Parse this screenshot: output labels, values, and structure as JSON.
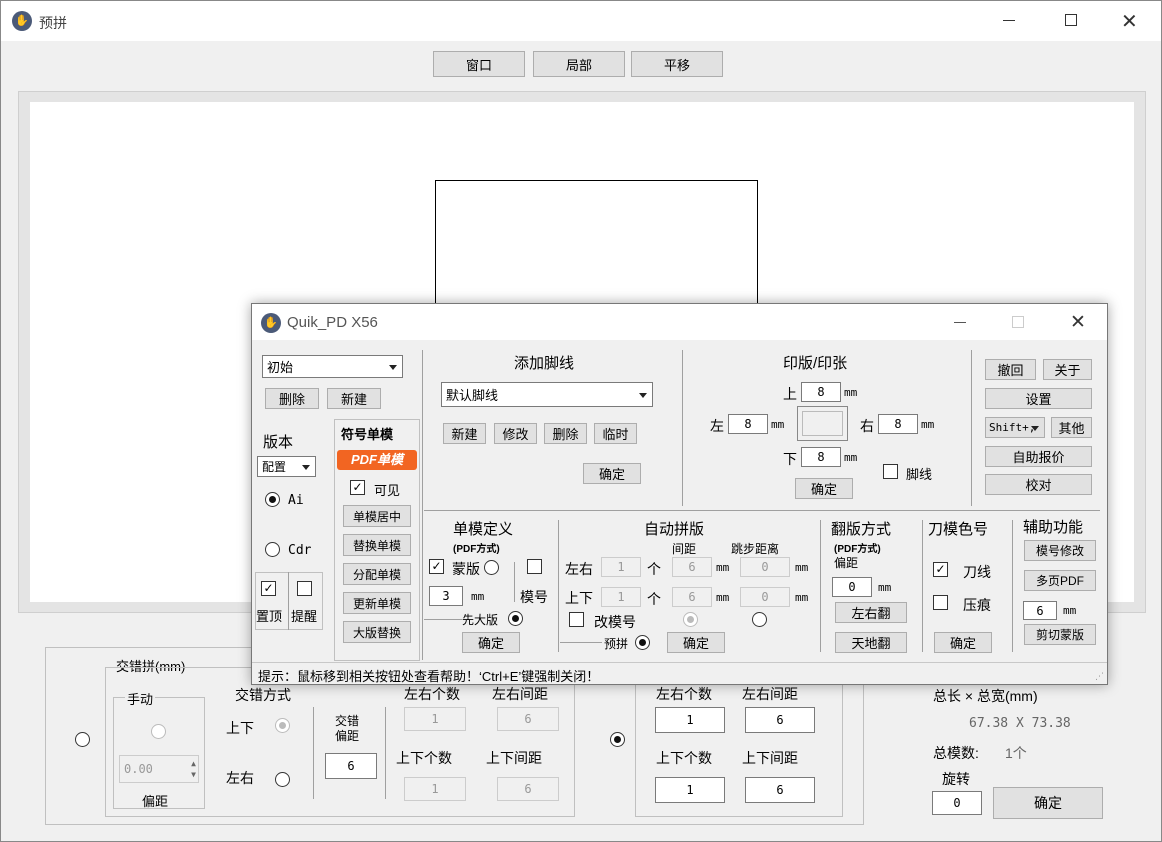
{
  "main": {
    "title": "预拼",
    "toolbar": {
      "window": "窗口",
      "partial": "局部",
      "pan": "平移"
    },
    "stagger": {
      "title": "交错拼(mm)",
      "manual_title": "手动",
      "spin_value": "0.00",
      "offset_label": "偏距",
      "mode_title": "交错方式",
      "mode_ud": "上下",
      "mode_lr": "左右",
      "offset_title": "交错\n偏距",
      "offset_value": "6",
      "lr_count_label": "左右个数",
      "lr_gap_label": "左右间距",
      "lr_count": "1",
      "lr_gap": "6",
      "ud_count_label": "上下个数",
      "ud_gap_label": "上下间距",
      "ud_count": "1",
      "ud_gap": "6"
    },
    "grid": {
      "lr_count_label": "左右个数",
      "lr_gap_label": "左右间距",
      "lr_count": "1",
      "lr_gap": "6",
      "ud_count_label": "上下个数",
      "ud_gap_label": "上下间距",
      "ud_count": "1",
      "ud_gap": "6"
    },
    "summary": {
      "size_label": "总长 × 总宽(mm)",
      "size_value": "67.38 X 73.38",
      "count_label": "总模数:",
      "count_value": "1个",
      "rotate_label": "旋转",
      "rotate_value": "0",
      "ok": "确定"
    }
  },
  "dialog": {
    "title": "Quik_PD X56",
    "left": {
      "preset": "初始",
      "delete": "删除",
      "new": "新建",
      "version_label": "版本",
      "config": "配置",
      "ai": "Ai",
      "cdr": "Cdr",
      "top_label": "置顶",
      "remind_label": "提醒"
    },
    "symbol": {
      "title": "符号单模",
      "pdf_badge": "PDF单模",
      "visible": "可见",
      "center": "单模居中",
      "replace": "替换单模",
      "assign": "分配单模",
      "update": "更新单模",
      "big_replace": "大版替换"
    },
    "footline": {
      "title": "添加脚线",
      "preset": "默认脚线",
      "new": "新建",
      "edit": "修改",
      "delete": "删除",
      "temp": "临时",
      "ok": "确定"
    },
    "plate": {
      "title": "印版/印张",
      "top": "上",
      "top_value": "8",
      "left": "左",
      "left_value": "8",
      "right": "右",
      "right_value": "8",
      "bottom": "下",
      "bottom_value": "8",
      "unit": "mm",
      "footline_check": "脚线",
      "ok": "确定"
    },
    "right": {
      "undo": "撤回",
      "about": "关于",
      "settings": "设置",
      "shift": "Shift+,",
      "other": "其他",
      "quote": "自助报价",
      "proof": "校对"
    },
    "single": {
      "title": "单模定义",
      "sub": "(PDF方式)",
      "mask": "蒙版",
      "mold_no": "模号",
      "value": "3",
      "unit": "mm",
      "big_first": "先大版",
      "ok": "确定"
    },
    "auto": {
      "title": "自动拼版",
      "gap_label": "间距",
      "step_label": "跳步距离",
      "lr": "左右",
      "ud": "上下",
      "lr_count": "1",
      "ud_count": "1",
      "each": "个",
      "lr_gap": "6",
      "ud_gap": "6",
      "lr_step": "0",
      "ud_step": "0",
      "unit": "mm",
      "change_no": "改模号",
      "preview": "预拼",
      "ok": "确定"
    },
    "flip": {
      "title": "翻版方式",
      "sub": "(PDF方式)",
      "offset_label": "偏距",
      "offset_value": "0",
      "unit": "mm",
      "lr_flip": "左右翻",
      "ud_flip": "天地翻"
    },
    "knife": {
      "title": "刀模色号",
      "knife_line": "刀线",
      "crease": "压痕",
      "ok": "确定"
    },
    "aux": {
      "title": "辅助功能",
      "mold_edit": "模号修改",
      "multi_pdf": "多页PDF",
      "value": "6",
      "unit": "mm",
      "cut_mask": "剪切蒙版"
    },
    "status": "提示：鼠标移到相关按钮处查看帮助！‘Ctrl+E’键强制关闭！"
  }
}
